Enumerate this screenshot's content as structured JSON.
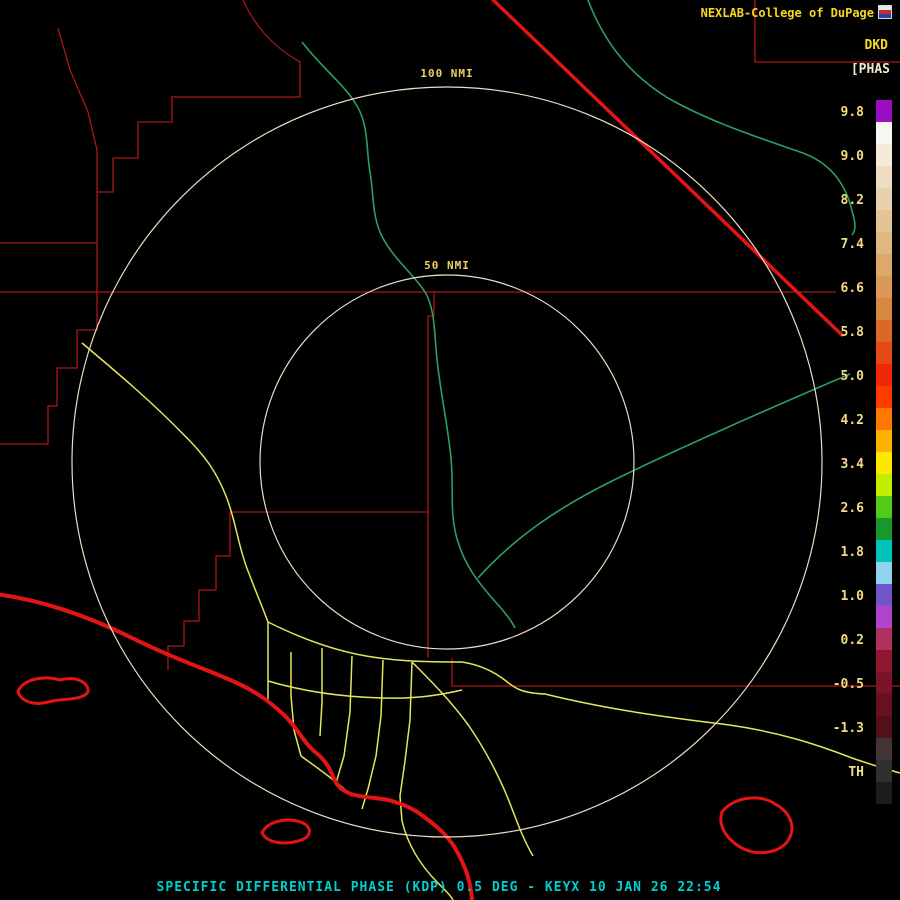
{
  "header": {
    "brand": "NEXLAB-College of DuPage",
    "product_code": "DKD",
    "product_units_label": "[PHAS"
  },
  "map": {
    "outer_ring_label": "100 NMI",
    "inner_ring_label": "50 NMI"
  },
  "colorbar": {
    "tick_labels": [
      "9.8",
      "9.0",
      "8.2",
      "7.4",
      "6.6",
      "5.8",
      "5.0",
      "4.2",
      "3.4",
      "2.6",
      "1.8",
      "1.0",
      "0.2",
      "-0.5",
      "-1.3",
      "TH"
    ],
    "segments": [
      "#9a10c0",
      "#f8f6f2",
      "#f4ead8",
      "#eeddc2",
      "#e8d0ac",
      "#e4c496",
      "#e0b682",
      "#dca86c",
      "#d89858",
      "#d88840",
      "#dc6828",
      "#e44814",
      "#f02808",
      "#ff3c00",
      "#ff7800",
      "#ffb000",
      "#ffe800",
      "#c0ee00",
      "#50cc18",
      "#189828",
      "#00c4bc",
      "#90d4ee",
      "#7054cc",
      "#b044c8",
      "#b03060",
      "#8c1830",
      "#7a1426",
      "#661020",
      "#54101a",
      "#403434",
      "#303030",
      "#1c1c1c"
    ]
  },
  "footer": {
    "caption": "SPECIFIC DIFFERENTIAL PHASE (KDP) 0.5 DEG - KEYX 10 JAN 26 22:54"
  },
  "colors": {
    "background": "#000000",
    "county_line": "#aa1616",
    "state_line": "#e41414",
    "coastline": "#e41414",
    "river": "#2aa060",
    "highway": "#e6e65a",
    "range_ring": "#efdcc3",
    "ring_label_text": "#eed063",
    "tick_label_text": "#f2dc82",
    "brand_text": "#f6d81e",
    "product_text": "#f6d81e",
    "units_text": "#efe9cf",
    "footer_text": "#00cfcf"
  }
}
